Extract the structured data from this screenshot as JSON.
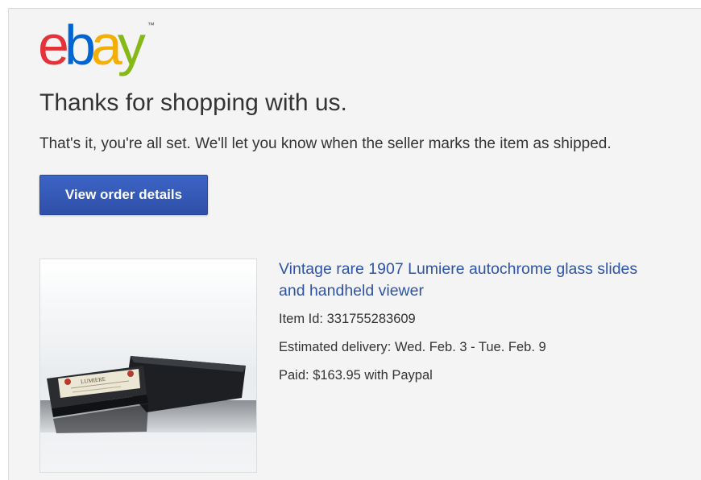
{
  "brand": {
    "logo_letters": [
      "e",
      "b",
      "a",
      "y"
    ],
    "logo_colors": [
      "#e53238",
      "#0064d2",
      "#f5af02",
      "#86b817"
    ],
    "trademark": "™"
  },
  "message": {
    "headline": "Thanks for shopping with us.",
    "subtext": "That's it, you're all set. We'll let you know when the seller marks the item as shipped."
  },
  "actions": {
    "view_order_label": "View order details"
  },
  "item": {
    "title": "Vintage rare 1907 Lumiere autochrome glass slides and handheld viewer",
    "item_id": "Item Id: 331755283609",
    "delivery": "Estimated delivery: Wed. Feb. 3 - Tue. Feb. 9",
    "paid": "Paid: $163.95 with Paypal",
    "image_label": "LUMIERE"
  },
  "colors": {
    "link": "#2d54a8",
    "button": "#3559b8",
    "background": "#f4f4f4"
  }
}
